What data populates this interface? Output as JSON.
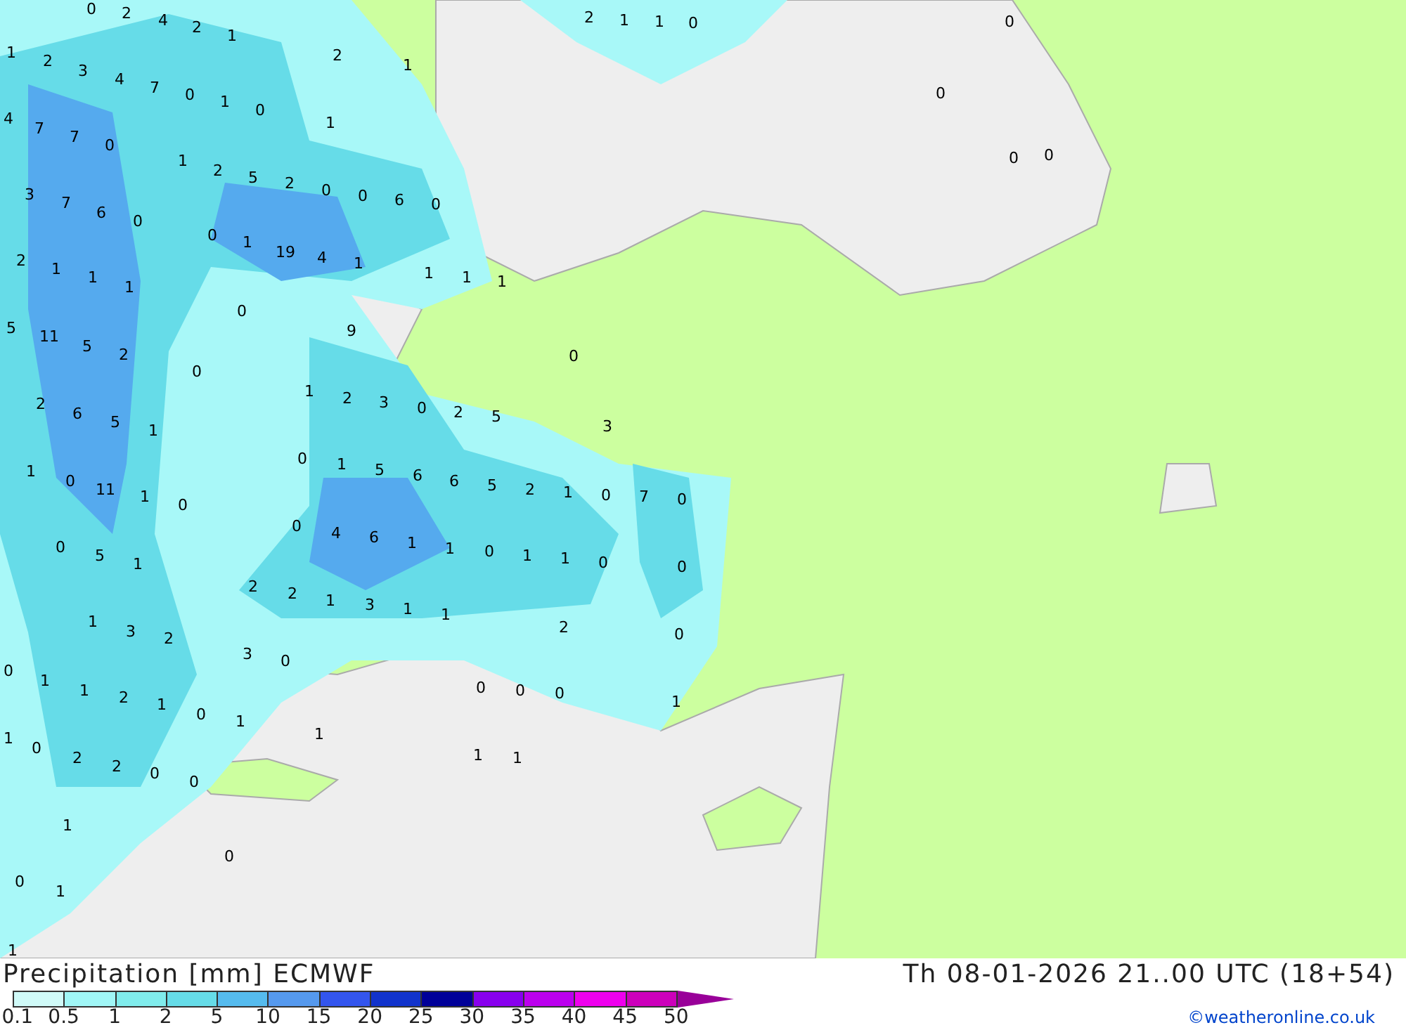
{
  "map": {
    "labels": [
      "0",
      "2",
      "4",
      "2",
      "1",
      "1",
      "2",
      "3",
      "4",
      "7",
      "0",
      "1",
      "0",
      "4",
      "7",
      "7",
      "0",
      "1",
      "2",
      "5",
      "2",
      "0",
      "0",
      "6",
      "0",
      "3",
      "7",
      "6",
      "0",
      "2",
      "1",
      "1",
      "1",
      "0",
      "1",
      "19",
      "4",
      "1",
      "1",
      "1",
      "1",
      "0",
      "5",
      "11",
      "5",
      "2",
      "9",
      "0",
      "1",
      "2",
      "3",
      "0",
      "2",
      "5",
      "0",
      "3",
      "2",
      "6",
      "5",
      "1",
      "1",
      "0",
      "11",
      "1",
      "0",
      "0",
      "5",
      "1",
      "0",
      "1",
      "5",
      "6",
      "6",
      "5",
      "2",
      "1",
      "0",
      "7",
      "0",
      "0",
      "4",
      "6",
      "1",
      "1",
      "0",
      "1",
      "1",
      "0",
      "0",
      "1",
      "3",
      "2",
      "2",
      "2",
      "1",
      "3",
      "1",
      "1",
      "2",
      "0",
      "3",
      "0",
      "0",
      "1",
      "1",
      "2",
      "1",
      "0",
      "1",
      "0",
      "0",
      "0",
      "1",
      "1",
      "0",
      "2",
      "2",
      "0",
      "0",
      "1",
      "1",
      "1",
      "1",
      "0",
      "0",
      "1",
      "1",
      "2",
      "1",
      "1",
      "0",
      "0",
      "0",
      "0",
      "0",
      "2",
      "1",
      "1"
    ]
  },
  "footer": {
    "title": "Precipitation [mm] ECMWF",
    "valid_time": "Th 08-01-2026 21..00 UTC (18+54)",
    "legend": {
      "bins": [
        {
          "color": "#d0faf8"
        },
        {
          "color": "#a0f6f6"
        },
        {
          "color": "#80ecec"
        },
        {
          "color": "#66dce8"
        },
        {
          "color": "#55bbee"
        },
        {
          "color": "#5599ee"
        },
        {
          "color": "#3355ee"
        },
        {
          "color": "#1133cc"
        },
        {
          "color": "#000099"
        },
        {
          "color": "#8800ee"
        },
        {
          "color": "#bb00ee"
        },
        {
          "color": "#ee00ee"
        },
        {
          "color": "#cc00bb"
        }
      ],
      "ticks": [
        "0.1",
        "0.5",
        "1",
        "2",
        "5",
        "10",
        "15",
        "20",
        "25",
        "30",
        "35",
        "40",
        "45",
        "50"
      ]
    },
    "credit": "©weatheronline.co.uk"
  }
}
